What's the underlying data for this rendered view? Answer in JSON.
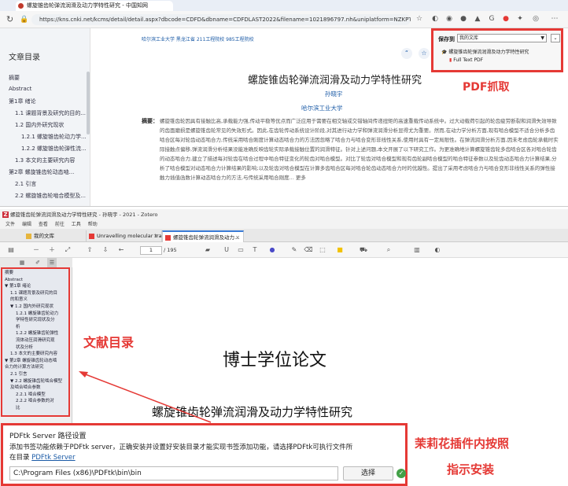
{
  "browser": {
    "tab_title": "螺旋锥齿轮弹流润滑及动力学特性研究 - 中国知网",
    "url": "https://kns.cnki.net/kcms/detail/detail.aspx?dbcode=CDFD&dbname=CDFDLAST2022&filename=1021896797.nh&uniplatform=NZKPT&v=u|y_LEDTo..."
  },
  "cnki": {
    "toc_title": "文章目录",
    "toc_items": [
      "摘要",
      "Abstract",
      "第1章 绪论",
      "1.1 课题背景及研究的目的...",
      "1.2 国内外研究现状",
      "1.2.1 螺旋锥齿轮动力学...",
      "1.2.2 螺旋锥齿轮弹性流...",
      "1.3 本文的主要研究内容",
      "第2章 螺旋锥齿轮动态啮...",
      "2.1 引言",
      "2.2 螺旋锥齿轮啮合模型及..."
    ],
    "school_links": "哈尔滨工业大学  黑龙江省 211工程院校 985工程院校",
    "title": "螺旋锥齿轮弹流润滑及动力学特性研究",
    "author": "孙晓宇",
    "school": "哈尔滨工业大学",
    "abstract_label": "摘要：",
    "abstract": "螺旋锥齿轮因具有接触比高,承载能力强,传动平稳等优点而广泛应用于需要在相交轴或交错轴间传递扭矩的高速重载传动系统中。过大动载荷引起的轮齿疲劳断裂和润滑失效导致的齿面磨损是螺旋锥齿轮常见的失效形式。因此,在齿轮传动系统设计阶段,对其进行动力学和弹流润滑分析显得尤为重要。然而,在动力学分析方面,现有啮合模型不适合分析多齿啮合区每对轮齿动态啮合力,传统采用啮合刚度计算动态啮合力的方法因忽略了啮合力与啮合变形非线性关系,使用时具有一定局限性。在弹流润滑分析方面,因未考虑齿轮承载时实际接触点偏移,弹流润滑分析结果没能准确反映齿轮实际承载接触位置的润滑特征。针对上述问题,本文开展了以下研究工作。为更准确地计算螺旋锥齿轮多齿啮合区各对啮合轮齿的动态啮合力,建立了描述每对轮齿在啮合过程中啮合特征变化的轮齿对啮合模型。对比了轮齿对啮合模型和现有齿轮副啮合模型的啮合特征参数以及轮齿动态啮合力计算结果,分析了啮合模型对动态啮合力计算结果的影响;以及轮齿对啮合模型在计算多齿啮合区每对啮合轮齿动态啮合力时的优越性。提出了采用考虑啮合力与啮合变形非线性关系的弹性接触力插值函数计算动态啮合力的方法,与传统采用啮合刚度... 更多"
  },
  "zotero_popup": {
    "save_to_label": "保存到",
    "library": "我的文库",
    "item_title": "螺旋锥齿轮弹流润滑及动力学特性研究",
    "attachment": "Full Text PDF"
  },
  "annotations": {
    "pdf_capture": "PDF抓取",
    "toc_label": "文献目录",
    "install_hint_line1": "茉莉花插件内按照",
    "install_hint_line2": "指示安装"
  },
  "zotero": {
    "window_title": "螺旋锥齿轮弹流润滑及动力学特性研究 - 孙晓宇 - 2021 - Zotero",
    "menu": [
      "文件",
      "编辑",
      "查看",
      "前往",
      "工具",
      "帮助"
    ],
    "tabs": [
      "我的文库",
      "Unravelling molecular tra...",
      "螺旋锥齿轮弹流润滑及动力..."
    ],
    "page_current": "1",
    "page_total": "/ 195",
    "outline": [
      {
        "t": "摘要",
        "lvl": 0
      },
      {
        "t": "Abstract",
        "lvl": 0
      },
      {
        "t": "▼ 第1章 绪论",
        "lvl": 0
      },
      {
        "t": "1.1 课题背景及研究的目",
        "lvl": 1
      },
      {
        "t": "的和意义",
        "lvl": 1
      },
      {
        "t": "▼ 1.2 国内外研究现状",
        "lvl": 1
      },
      {
        "t": "1.2.1 螺旋锥齿轮动力",
        "lvl": 2
      },
      {
        "t": "学特性研究现状及分",
        "lvl": 2
      },
      {
        "t": "析",
        "lvl": 2
      },
      {
        "t": "1.2.2 螺旋锥齿轮弹性",
        "lvl": 2
      },
      {
        "t": "流体动压润滑研究现",
        "lvl": 2
      },
      {
        "t": "状及分析",
        "lvl": 2
      },
      {
        "t": "1.3 本文的主要研究内容",
        "lvl": 1
      },
      {
        "t": "▼ 第2章 螺旋锥齿轮动态啮",
        "lvl": 0
      },
      {
        "t": "合力的计算方法研究",
        "lvl": 0
      },
      {
        "t": "2.1 引言",
        "lvl": 1
      },
      {
        "t": "▼ 2.2 螺旋锥齿轮啮合模型",
        "lvl": 1
      },
      {
        "t": "及啮合啮合参数",
        "lvl": 1
      },
      {
        "t": "2.2.1 啮合模型",
        "lvl": 2
      },
      {
        "t": "2.2.2 啮合参数的对",
        "lvl": 2
      },
      {
        "t": "比",
        "lvl": 2
      }
    ],
    "doc_title": "博士学位论文",
    "doc_subtitle": "螺旋锥齿轮弹流润滑及动力学特性研究"
  },
  "pdftk_dialog": {
    "title": "PDFtk Server 路径设置",
    "desc_line1": "添加书签功能依赖于PDFtk server，正确安装并设置好安装目录才能实现书签添加功能，请选择PDFtk可执行文件所",
    "desc_line2_prefix": "在目录 ",
    "desc_link": "PDFtk Server",
    "path": "C:\\Program Files (x86)\\PDFtk\\bin\\bin",
    "browse_label": "选择"
  }
}
